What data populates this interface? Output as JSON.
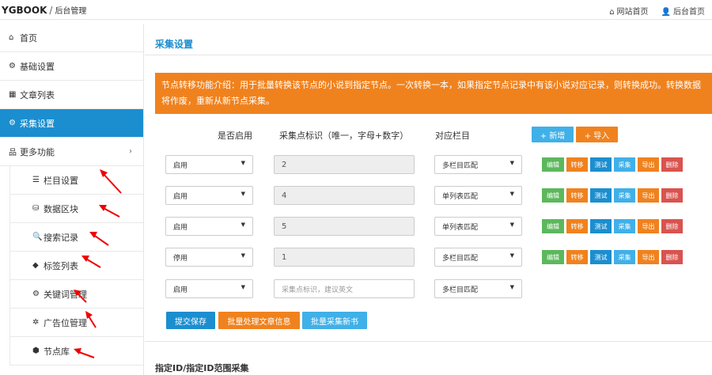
{
  "header": {
    "brand": "YGBOOK",
    "separator": "/",
    "subtitle": "后台管理",
    "links": [
      {
        "icon": "home-icon",
        "label": "网站首页"
      },
      {
        "icon": "user-icon",
        "label": "后台首页"
      }
    ]
  },
  "sidebar": {
    "items": [
      {
        "icon": "home-icon",
        "label": "首页"
      },
      {
        "icon": "gear-icon",
        "label": "基础设置"
      },
      {
        "icon": "table-icon",
        "label": "文章列表"
      },
      {
        "icon": "gears-icon",
        "label": "采集设置"
      },
      {
        "icon": "sitemap-icon",
        "label": "更多功能"
      }
    ],
    "sub_items": [
      {
        "icon": "list-icon",
        "label": "栏目设置"
      },
      {
        "icon": "database-icon",
        "label": "数据区块"
      },
      {
        "icon": "search-icon",
        "label": "搜索记录"
      },
      {
        "icon": "tag-icon",
        "label": "标签列表"
      },
      {
        "icon": "gears-icon",
        "label": "关键词管理"
      },
      {
        "icon": "ad-icon",
        "label": "广告位管理"
      },
      {
        "icon": "cube-icon",
        "label": "节点库"
      }
    ]
  },
  "main": {
    "title": "采集设置",
    "notice": "节点转移功能介绍：用于批量转换该节点的小说到指定节点。一次转换一本，如果指定节点记录中有该小说对应记录，则转换成功。转换数据将作废，重新从新节点采集。",
    "columns": {
      "enabled": "是否启用",
      "node_id": "采集点标识（唯一，字母+数字）",
      "category": "对应栏目"
    },
    "add_label": "+ 新增",
    "import_label": "+ 导入",
    "rows": [
      {
        "enabled": "启用",
        "node": "2",
        "category": "多栏目匹配",
        "actions": true
      },
      {
        "enabled": "启用",
        "node": "4",
        "category": "单列表匹配",
        "actions": true
      },
      {
        "enabled": "启用",
        "node": "5",
        "category": "单列表匹配",
        "actions": true
      },
      {
        "enabled": "停用",
        "node": "1",
        "category": "多栏目匹配",
        "actions": true
      },
      {
        "enabled": "启用",
        "node": "",
        "category": "多栏目匹配",
        "actions": false
      }
    ],
    "node_placeholder": "采集点标识，建议英文",
    "actions": {
      "edit": "编辑",
      "move": "转移",
      "test": "测试",
      "collect": "采集",
      "export": "导出",
      "delete": "删除"
    },
    "submit_label": "提交保存",
    "batch_process_label": "批量处理文章信息",
    "batch_collect_label": "批量采集新书",
    "section2_title": "指定ID/指定ID范围采集"
  },
  "colors": {
    "primary": "#1b8ecf",
    "orange": "#f0821e",
    "green": "#5cb85c",
    "red": "#d9534f",
    "cyan": "#40b0e8"
  }
}
